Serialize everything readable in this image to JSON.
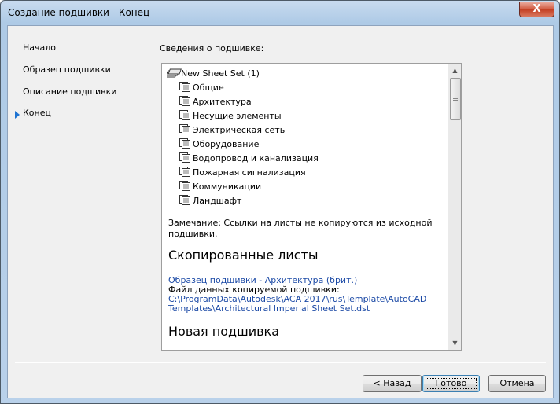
{
  "window": {
    "title": "Создание подшивки - Конец",
    "close_glyph": "X"
  },
  "nav": {
    "items": [
      {
        "label": "Начало",
        "active": false
      },
      {
        "label": "Образец подшивки",
        "active": false
      },
      {
        "label": "Описание подшивки",
        "active": false
      },
      {
        "label": "Конец",
        "active": true
      }
    ]
  },
  "main": {
    "section_label": "Сведения о подшивке:",
    "tree": {
      "root": {
        "label": "New Sheet Set (1)",
        "icon": "sheet-set-icon"
      },
      "children": [
        {
          "label": "Общие",
          "icon": "subset-icon"
        },
        {
          "label": "Архитектура",
          "icon": "subset-icon"
        },
        {
          "label": "Несущие элементы",
          "icon": "subset-icon"
        },
        {
          "label": "Электрическая сеть",
          "icon": "subset-icon"
        },
        {
          "label": "Оборудование",
          "icon": "subset-icon"
        },
        {
          "label": "Водопровод и канализация",
          "icon": "subset-icon"
        },
        {
          "label": "Пожарная сигнализация",
          "icon": "subset-icon"
        },
        {
          "label": "Коммуникации",
          "icon": "subset-icon"
        },
        {
          "label": "Ландшафт",
          "icon": "subset-icon"
        }
      ]
    },
    "note": "Замечание: Ссылки на листы не копируются из исходной подшивки.",
    "copied_heading": "Скопированные листы",
    "source_link": "Образец подшивки - Архитектура (брит.)",
    "source_file_label": "Файл данных копируемой подшивки:",
    "source_path_line1": "C:\\ProgramData\\Autodesk\\ACA 2017\\rus\\Template\\AutoCAD",
    "source_path_line2": "Templates\\Architectural Imperial Sheet Set.dst",
    "new_heading": "Новая подшивка"
  },
  "buttons": {
    "back": "< Назад",
    "finish": "Готово",
    "cancel": "Отмена"
  },
  "colors": {
    "link": "#1c4aa6",
    "nav_arrow": "#1e73d1",
    "close_button": "#c44024"
  }
}
